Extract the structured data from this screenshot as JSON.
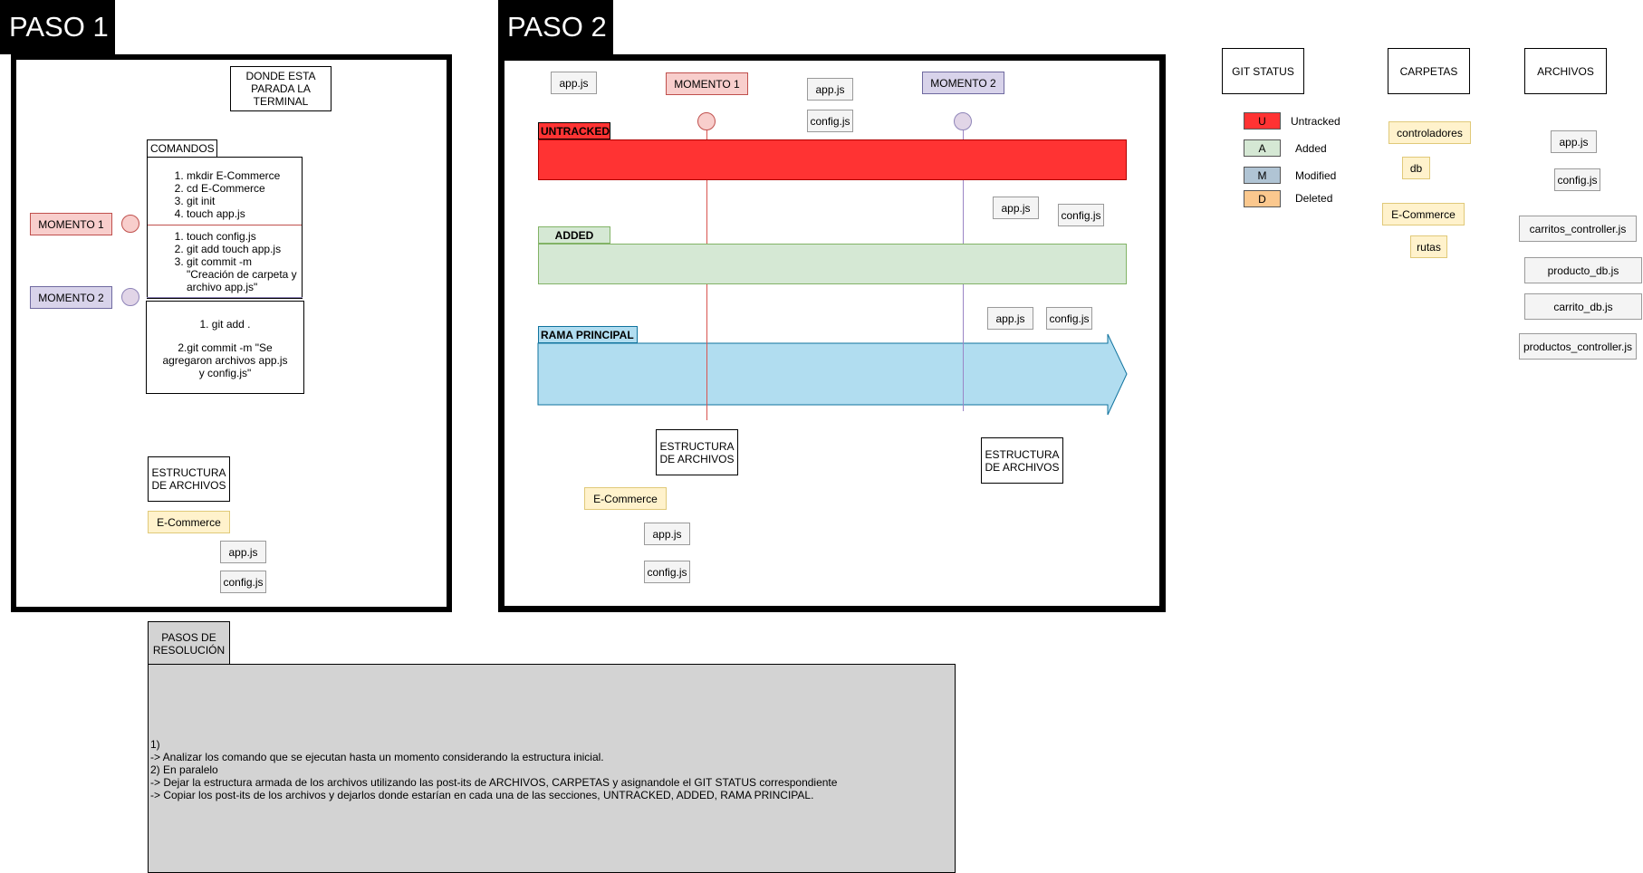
{
  "paso1": {
    "title": "PASO 1",
    "terminal_box": "DONDE ESTA PARADA LA TERMINAL",
    "comandos_label": "COMANDOS",
    "group1": [
      "mkdir E-Commerce",
      "cd E-Commerce",
      "git init",
      "touch app.js"
    ],
    "group2": [
      "touch config.js",
      "git add touch app.js",
      "git commit -m \"Creación de carpeta y archivo app.js\""
    ],
    "group3_line1": "1. git add .",
    "group3_line2": "2.git commit -m \"Se agregaron archivos app.js y config.js\"",
    "momento1": "MOMENTO 1",
    "momento2": "MOMENTO 2",
    "estructura": "ESTRUCTURA DE ARCHIVOS",
    "folder": "E-Commerce",
    "file1": "app.js",
    "file2": "config.js"
  },
  "paso2": {
    "title": "PASO 2",
    "momento1": "MOMENTO 1",
    "momento2": "MOMENTO 2",
    "untracked": "UNTRACKED",
    "added": "ADDED",
    "rama": "RAMA PRINCIPAL",
    "estructura1": "ESTRUCTURA DE ARCHIVOS",
    "estructura2": "ESTRUCTURA DE ARCHIVOS",
    "top_app_left": "app.js",
    "top_app_mid": "app.js",
    "top_config_mid": "config.js",
    "added_app": "app.js",
    "added_config": "config.js",
    "rama_app": "app.js",
    "rama_config": "config.js",
    "bottom_folder": "E-Commerce",
    "bottom_app": "app.js",
    "bottom_config": "config.js"
  },
  "legend": {
    "git_status": "GIT STATUS",
    "carpetas": "CARPETAS",
    "archivos": "ARCHIVOS",
    "status": [
      {
        "key": "U",
        "label": "Untracked",
        "color": "#ff3333"
      },
      {
        "key": "A",
        "label": "Added",
        "color": "#d5e8d4"
      },
      {
        "key": "M",
        "label": "Modified",
        "color": "#b0c4d4"
      },
      {
        "key": "D",
        "label": "Deleted",
        "color": "#fbc88e"
      }
    ],
    "folders": [
      "controladores",
      "db",
      "E-Commerce",
      "rutas"
    ],
    "files": [
      "app.js",
      "config.js",
      "carritos_controller.js",
      "producto_db.js",
      "carrito_db.js",
      "productos_controller.js"
    ]
  },
  "pasos": {
    "title": "PASOS DE RESOLUCIÓN",
    "lines": [
      "1)",
      "-> Analizar los comando que se ejecutan hasta un momento considerando la estructura inicial.",
      "2) En paralelo",
      "-> Dejar la estructura armada de los archivos utilizando las post-its de ARCHIVOS, CARPETAS y asignandole el GIT STATUS correspondiente",
      "-> Copiar los post-its de los archivos y dejarlos donde estarían en cada una de las secciones, UNTRACKED, ADDED, RAMA PRINCIPAL."
    ]
  },
  "colors": {
    "untracked": "#ff3333",
    "added": "#d5e8d4",
    "rama": "#b1ddf0",
    "folder": "#fff2cc",
    "momento1": "#f8cecc",
    "momento2": "#d8d3ea",
    "panel": "#d3d3d3"
  }
}
